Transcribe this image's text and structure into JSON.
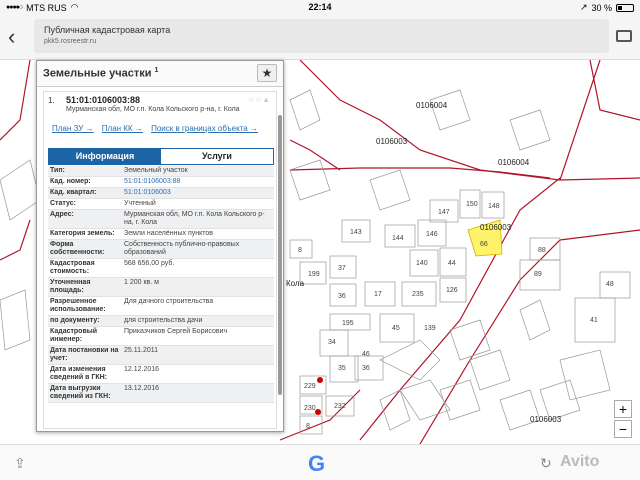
{
  "status": {
    "carrier": "MTS RUS",
    "time": "22:14",
    "battery": "30 %"
  },
  "browser": {
    "title": "Публичная кадастровая карта",
    "url": "pkk5.rosreestr.ru"
  },
  "panel": {
    "title": "Земельные участки",
    "count": "1",
    "item": {
      "num": "1.",
      "cad_number": "51:01:0106003:88",
      "address": "Мурманская обл, МО г.п. Кола Кольского р-на, г. Кола",
      "links": [
        "План ЗУ →",
        "План КК →",
        "Поиск в границах объекта →"
      ]
    },
    "tabs": [
      "Информация",
      "Услуги"
    ],
    "rows": [
      {
        "k": "Тип:",
        "v": "Земельный участок"
      },
      {
        "k": "Кад. номер:",
        "v": "51:01:0106003:88"
      },
      {
        "k": "Кад. квартал:",
        "v": "51:01:0106003"
      },
      {
        "k": "Статус:",
        "v": "Учтенный"
      },
      {
        "k": "Адрес:",
        "v": "Мурманская обл, МО г.п. Кола Кольского р-на, г. Кола"
      },
      {
        "k": "Категория земель:",
        "v": "Земли населённых пунктов"
      },
      {
        "k": "Форма собственности:",
        "v": "Собственность публично-правовых образований"
      },
      {
        "k": "Кадастровая стоимость:",
        "v": "568 656,00 руб."
      },
      {
        "k": "Уточненная площадь:",
        "v": "1 200 кв. м"
      },
      {
        "k": "Разрешенное использование:",
        "v": "Для дачного строительства"
      },
      {
        "k": "по документу:",
        "v": "для строительства дачи"
      },
      {
        "k": "Кадастровый инженер:",
        "v": "Приказчиков Сергей Борисович"
      },
      {
        "k": "Дата постановки на учет:",
        "v": "25.11.2011"
      },
      {
        "k": "Дата изменения сведений в ГКН:",
        "v": "12.12.2016"
      },
      {
        "k": "Дата выгрузки сведений из ГКН:",
        "v": "13.12.2016"
      }
    ]
  },
  "map": {
    "quarter_labels": [
      "0106004",
      "0106003",
      "0106004",
      "0106003",
      "Кола",
      "0106003",
      "106004"
    ],
    "parcel_labels": [
      "147",
      "150",
      "148",
      "144",
      "146",
      "140",
      "44",
      "143",
      "8",
      "37",
      "36",
      "199",
      "17",
      "235",
      "126",
      "66",
      "88",
      "89",
      "48",
      "41",
      "195",
      "45",
      "34",
      "35",
      "36",
      "46",
      "139",
      "229",
      "232",
      "230",
      "8"
    ]
  },
  "colors": {
    "highlight": "#fff36b",
    "road": "#b0162a",
    "panel_tab": "#1b64a6"
  }
}
